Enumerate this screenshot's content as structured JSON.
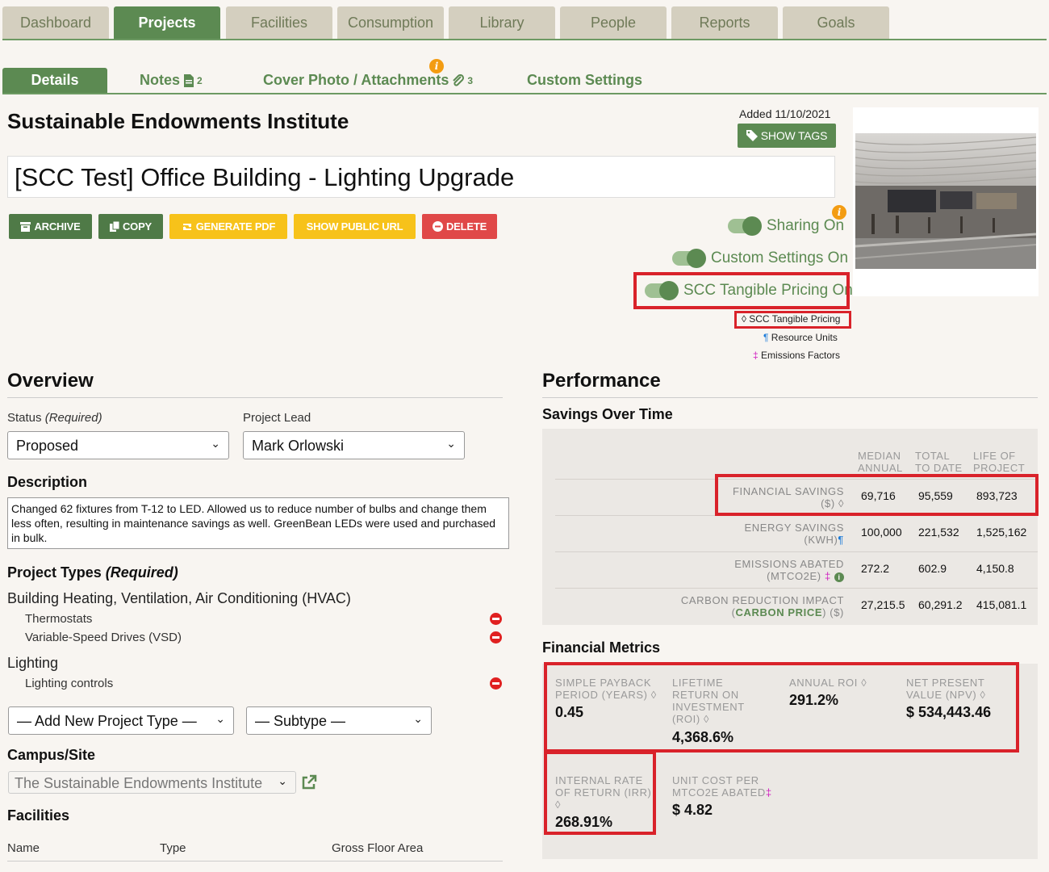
{
  "top_tabs": [
    "Dashboard",
    "Projects",
    "Facilities",
    "Consumption",
    "Library",
    "People",
    "Reports",
    "Goals"
  ],
  "sub_tabs": {
    "details": "Details",
    "notes": "Notes",
    "notes_count": "2",
    "cover": "Cover Photo / Attachments",
    "cover_count": "3",
    "custom": "Custom Settings",
    "info_badge": "i"
  },
  "org_name": "Sustainable Endowments Institute",
  "added": "Added 11/10/2021",
  "show_tags": "SHOW TAGS",
  "project_title": "[SCC Test] Office Building - Lighting Upgrade",
  "actions": {
    "archive": "ARCHIVE",
    "copy": "COPY",
    "pdf": "GENERATE PDF",
    "public_url": "SHOW PUBLIC URL",
    "delete": "DELETE"
  },
  "toggles": {
    "sharing": "Sharing On",
    "custom_settings": "Custom Settings On",
    "scc": "SCC Tangible Pricing On"
  },
  "legend": {
    "scc": "◊ SCC Tangible Pricing",
    "resource": "¶ Resource Units",
    "emissions": "‡ Emissions Factors"
  },
  "overview": {
    "title": "Overview",
    "status_label": "Status",
    "status_required": "(Required)",
    "status_value": "Proposed",
    "lead_label": "Project Lead",
    "lead_value": "Mark Orlowski",
    "description_label": "Description",
    "description": "Changed 62 fixtures from T-12 to LED. Allowed us to reduce number of bulbs and change them less often, resulting in maintenance savings as well. GreenBean LEDs were used and purchased in bulk.",
    "types_label": "Project Types",
    "types_required": "(Required)",
    "type_group1": "Building Heating, Ventilation, Air Conditioning (HVAC)",
    "type_g1_a": "Thermostats",
    "type_g1_b": "Variable-Speed Drives (VSD)",
    "type_group2": "Lighting",
    "type_g2_a": "Lighting controls",
    "add_type": "— Add New Project Type —",
    "subtype": "— Subtype —",
    "campus_label": "Campus/Site",
    "campus_value": "The Sustainable Endowments Institute",
    "facilities_label": "Facilities",
    "col_name": "Name",
    "col_type": "Type",
    "col_area": "Gross Floor Area"
  },
  "performance": {
    "title": "Performance",
    "savings_title": "Savings Over Time",
    "col_median": "MEDIAN ANNUAL",
    "col_total": "TOTAL TO DATE",
    "col_life": "LIFE OF PROJECT",
    "rows": [
      {
        "label": "FINANCIAL SAVINGS",
        "unit": "($) ◊",
        "median": "69,716",
        "total": "95,559",
        "life": "893,723"
      },
      {
        "label": "ENERGY SAVINGS",
        "unit": "(KWH)",
        "median": "100,000",
        "total": "221,532",
        "life": "1,525,162"
      },
      {
        "label": "EMISSIONS ABATED",
        "unit": "(MTCO2E)",
        "median": "272.2",
        "total": "602.9",
        "life": "4,150.8"
      },
      {
        "label": "CARBON REDUCTION IMPACT",
        "unit": "(CARBON PRICE) ($)",
        "median": "27,215.5",
        "total": "60,291.2",
        "life": "415,081.1"
      }
    ],
    "carbon_price": "CARBON PRICE"
  },
  "financial": {
    "title": "Financial Metrics",
    "payback_label": "SIMPLE PAYBACK PERIOD (YEARS) ◊",
    "payback": "0.45",
    "lroi_label": "LIFETIME RETURN ON INVESTMENT (ROI) ◊",
    "lroi": "4,368.6%",
    "aroi_label": "ANNUAL ROI ◊",
    "aroi": "291.2%",
    "npv_label": "NET PRESENT VALUE (NPV) ◊",
    "npv": "$ 534,443.46",
    "irr_label": "INTERNAL RATE OF RETURN (IRR) ◊",
    "irr": "268.91%",
    "unitcost_label": "UNIT COST PER MTCO2E ABATED",
    "unitcost": "$ 4.82"
  },
  "colors": {
    "brand_green": "#5c8a52",
    "tab_gray": "#d4cfbf",
    "highlight_red": "#d9222a",
    "yellow": "#f7c21a",
    "danger": "#e04848"
  }
}
